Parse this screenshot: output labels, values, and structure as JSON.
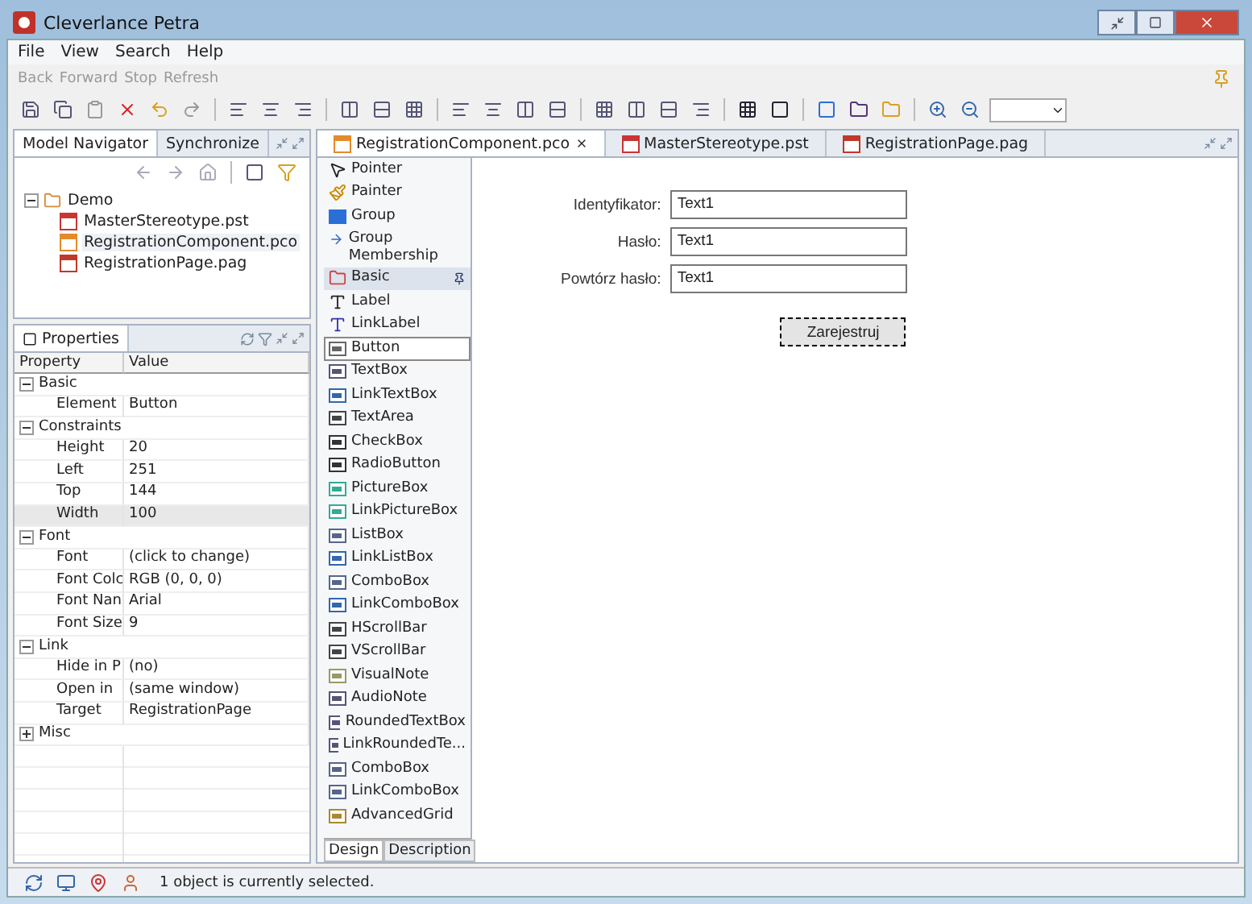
{
  "window": {
    "title": "Cleverlance Petra"
  },
  "menu": [
    "File",
    "View",
    "Search",
    "Help"
  ],
  "nav_toolbar": [
    "Back",
    "Forward",
    "Stop",
    "Refresh"
  ],
  "navigator": {
    "tabs": [
      {
        "label": "Model Navigator",
        "selected": true
      },
      {
        "label": "Synchronize",
        "selected": false
      }
    ],
    "tree": [
      {
        "label": "Demo",
        "kind": "folder",
        "expanded": true,
        "selected": false,
        "children": [
          {
            "label": "MasterStereotype.pst",
            "kind": "stereotype",
            "selected": false
          },
          {
            "label": "RegistrationComponent.pco",
            "kind": "component",
            "selected": true
          },
          {
            "label": "RegistrationPage.pag",
            "kind": "page",
            "selected": false
          }
        ]
      }
    ]
  },
  "properties": {
    "tab": "Properties",
    "columns": [
      "Property",
      "Value"
    ],
    "rows": [
      {
        "kind": "category",
        "name": "Basic",
        "expanded": true,
        "selected": false
      },
      {
        "kind": "property",
        "name": "Element",
        "value": "Button",
        "selected": false
      },
      {
        "kind": "category",
        "name": "Constraints",
        "expanded": true,
        "selected": false
      },
      {
        "kind": "property",
        "name": "Height",
        "value": "20",
        "selected": false
      },
      {
        "kind": "property",
        "name": "Left",
        "value": "251",
        "selected": false
      },
      {
        "kind": "property",
        "name": "Top",
        "value": "144",
        "selected": false
      },
      {
        "kind": "property",
        "name": "Width",
        "value": "100",
        "selected": true
      },
      {
        "kind": "category",
        "name": "Font",
        "expanded": true,
        "selected": false
      },
      {
        "kind": "property",
        "name": "Font",
        "value": "(click to change)",
        "selected": false
      },
      {
        "kind": "property",
        "name": "Font Colc",
        "value": "RGB (0, 0, 0)",
        "selected": false
      },
      {
        "kind": "property",
        "name": "Font Nan",
        "value": "Arial",
        "selected": false
      },
      {
        "kind": "property",
        "name": "Font Size",
        "value": "9",
        "selected": false
      },
      {
        "kind": "category",
        "name": "Link",
        "expanded": true,
        "selected": false
      },
      {
        "kind": "property",
        "name": "Hide in P",
        "value": "(no)",
        "selected": false
      },
      {
        "kind": "property",
        "name": "Open in",
        "value": "(same window)",
        "selected": false
      },
      {
        "kind": "property",
        "name": "Target",
        "value": "RegistrationPage",
        "selected": false
      },
      {
        "kind": "category",
        "name": "Misc",
        "expanded": false,
        "selected": false
      }
    ]
  },
  "editor_tabs": [
    {
      "label": "RegistrationComponent.pco",
      "kind": "component",
      "selected": true
    },
    {
      "label": "MasterStereotype.pst",
      "kind": "stereotype",
      "selected": false
    },
    {
      "label": "RegistrationPage.pag",
      "kind": "page",
      "selected": false
    }
  ],
  "palette": {
    "items": [
      {
        "label": "Pointer",
        "kind": "pointer",
        "selected": false
      },
      {
        "label": "Painter",
        "kind": "painter",
        "selected": false
      },
      {
        "label": "Group",
        "kind": "group",
        "selected": false
      },
      {
        "label": "Group Membership",
        "kind": "membership",
        "selected": false
      },
      {
        "label": "Basic",
        "kind": "category",
        "selected": false
      },
      {
        "label": "Label",
        "kind": "label",
        "selected": false
      },
      {
        "label": "LinkLabel",
        "kind": "link-label",
        "selected": false
      },
      {
        "label": "Button",
        "kind": "button",
        "selected": true
      },
      {
        "label": "TextBox",
        "kind": "text",
        "selected": false
      },
      {
        "label": "LinkTextBox",
        "kind": "link",
        "selected": false
      },
      {
        "label": "TextArea",
        "kind": "area",
        "selected": false
      },
      {
        "label": "CheckBox",
        "kind": "check",
        "selected": false
      },
      {
        "label": "RadioButton",
        "kind": "radio",
        "selected": false
      },
      {
        "label": "PictureBox",
        "kind": "picture",
        "selected": false
      },
      {
        "label": "LinkPictureBox",
        "kind": "picture",
        "selected": false
      },
      {
        "label": "ListBox",
        "kind": "list",
        "selected": false
      },
      {
        "label": "LinkListBox",
        "kind": "link",
        "selected": false
      },
      {
        "label": "ComboBox",
        "kind": "list",
        "selected": false
      },
      {
        "label": "LinkComboBox",
        "kind": "link",
        "selected": false
      },
      {
        "label": "HScrollBar",
        "kind": "scroll",
        "selected": false
      },
      {
        "label": "VScrollBar",
        "kind": "scroll",
        "selected": false
      },
      {
        "label": "VisualNote",
        "kind": "note",
        "selected": false
      },
      {
        "label": "AudioNote",
        "kind": "audio",
        "selected": false
      },
      {
        "label": "RoundedTextBox",
        "kind": "text",
        "selected": false
      },
      {
        "label": "LinkRoundedTe...",
        "kind": "text",
        "selected": false
      },
      {
        "label": "ComboBox",
        "kind": "combo",
        "selected": false
      },
      {
        "label": "LinkComboBox",
        "kind": "combo",
        "selected": false
      },
      {
        "label": "AdvancedGrid",
        "kind": "grid",
        "selected": false
      }
    ],
    "tabs": [
      {
        "label": "Design",
        "selected": true
      },
      {
        "label": "Description",
        "selected": false
      }
    ]
  },
  "form": {
    "fields": [
      {
        "label": "Identyfikator:",
        "value": "Text1"
      },
      {
        "label": "Hasło:",
        "value": "Text1"
      },
      {
        "label": "Powtórz hasło:",
        "value": "Text1"
      }
    ],
    "button": {
      "label": "Zarejestruj",
      "selected": true
    }
  },
  "status_bar": {
    "message": "1 object is currently selected."
  }
}
